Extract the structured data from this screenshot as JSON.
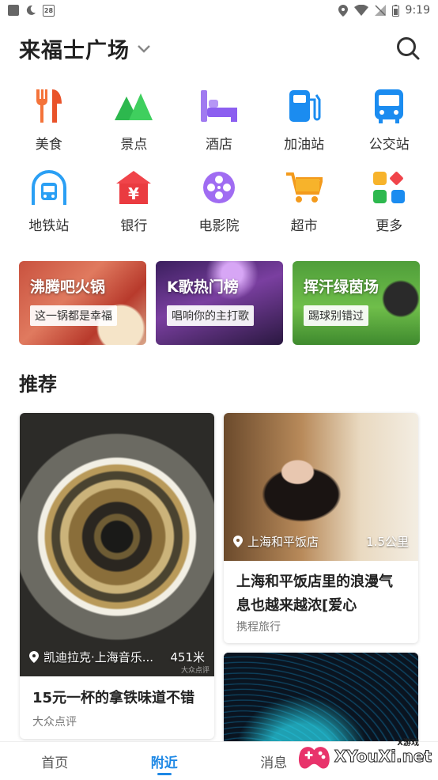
{
  "status_bar": {
    "time": "9:19",
    "calendar_day": "28"
  },
  "header": {
    "location": "来福士广场"
  },
  "categories": [
    {
      "label": "美食",
      "icon": "fork-knife-icon"
    },
    {
      "label": "景点",
      "icon": "mountain-icon"
    },
    {
      "label": "酒店",
      "icon": "bed-icon"
    },
    {
      "label": "加油站",
      "icon": "gas-pump-icon"
    },
    {
      "label": "公交站",
      "icon": "bus-icon"
    },
    {
      "label": "地铁站",
      "icon": "subway-icon"
    },
    {
      "label": "银行",
      "icon": "bank-icon"
    },
    {
      "label": "电影院",
      "icon": "film-reel-icon"
    },
    {
      "label": "超市",
      "icon": "cart-icon"
    },
    {
      "label": "更多",
      "icon": "grid-more-icon"
    }
  ],
  "banners": [
    {
      "title": "沸腾吧火锅",
      "subtitle": "这一锅都是幸福"
    },
    {
      "title": "K歌热门榜",
      "subtitle": "唱响你的主打歌"
    },
    {
      "title": "挥汗绿茵场",
      "subtitle": "踢球别错过"
    }
  ],
  "recommend": {
    "title": "推荐",
    "cards": [
      {
        "location": "凯迪拉克·上海音乐...",
        "distance": "451米",
        "title": "15元一杯的拿铁味道不错",
        "source": "大众点评",
        "watermark": "大众点评"
      },
      {
        "location": "上海和平饭店",
        "distance": "1.5公里",
        "title": "上海和平饭店里的浪漫气息也越来越浓[爱心",
        "source": "携程旅行"
      }
    ]
  },
  "tabbar": {
    "tabs": [
      "首页",
      "附近",
      "消息"
    ],
    "active": 1
  },
  "watermark": {
    "brand": "XYouXi.net",
    "small": "X游戏"
  },
  "colors": {
    "accent": "#1e88e5"
  }
}
